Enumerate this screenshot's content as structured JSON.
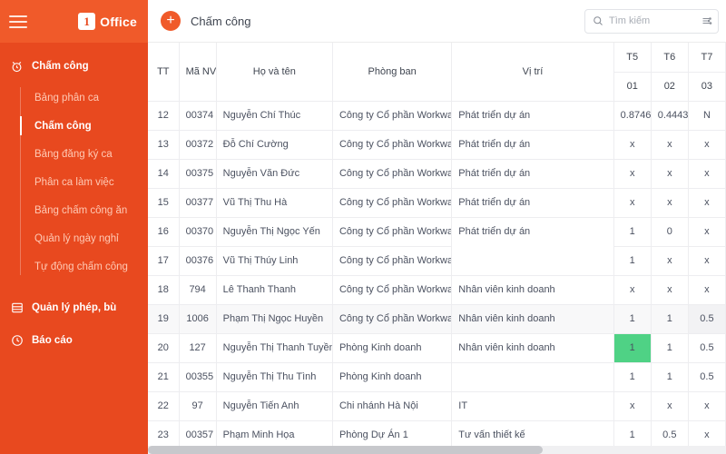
{
  "sidebar": {
    "brand_label": "Office",
    "brand_mark": "1",
    "menu_icon": "hamburger-icon",
    "sections": [
      {
        "label": "Chấm công",
        "icon": "alarm-clock-icon",
        "children": [
          {
            "label": "Bảng phân ca",
            "active": false
          },
          {
            "label": "Chấm công",
            "active": true
          },
          {
            "label": "Bảng đăng ký ca",
            "active": false
          },
          {
            "label": "Phân ca làm việc",
            "active": false
          },
          {
            "label": "Bảng chấm công ăn",
            "active": false
          },
          {
            "label": "Quản lý ngày nghỉ",
            "active": false
          },
          {
            "label": "Tự động chấm công",
            "active": false
          }
        ]
      }
    ],
    "bottom_items": [
      {
        "label": "Quản lý phép, bù",
        "icon": "list-icon"
      },
      {
        "label": "Báo cáo",
        "icon": "clock-icon"
      }
    ],
    "colors": {
      "bar": "#F05A2A",
      "body": "#E8491F",
      "sub_text": "#FFC9B4"
    }
  },
  "topbar": {
    "add_label": "+",
    "page_title": "Chấm công",
    "search": {
      "placeholder": "Tìm kiếm",
      "value": ""
    },
    "search_icon": "search-icon",
    "filter_icon": "sliders-icon"
  },
  "table": {
    "headers": {
      "tt": "TT",
      "ma_nv": "Mã NV",
      "ho_ten": "Họ và tên",
      "phong_ban": "Phòng ban",
      "vi_tri": "Vị trí"
    },
    "day_columns": [
      {
        "weekday": "T5",
        "day": "01",
        "weekend": false
      },
      {
        "weekday": "T6",
        "day": "02",
        "weekend": false
      },
      {
        "weekday": "T7",
        "day": "03",
        "weekend": true
      }
    ],
    "rows": [
      {
        "tt": "12",
        "ma_nv": "00374",
        "ho_ten": "Nguyễn Chí Thúc",
        "phong_ban": "Công ty Cổ phần Workway",
        "vi_tri": "Phát triển dự án",
        "days": [
          {
            "v": "0.8746",
            "style": "red"
          },
          {
            "v": "0.4443",
            "style": "red"
          },
          {
            "v": "N",
            "style": "normal"
          }
        ],
        "alt": false
      },
      {
        "tt": "13",
        "ma_nv": "00372",
        "ho_ten": "Đỗ Chí Cường",
        "phong_ban": "Công ty Cổ phần Workway",
        "vi_tri": "Phát triển dự án",
        "days": [
          {
            "v": "x",
            "style": "normal"
          },
          {
            "v": "x",
            "style": "normal"
          },
          {
            "v": "x",
            "style": "normal"
          }
        ],
        "alt": false
      },
      {
        "tt": "14",
        "ma_nv": "00375",
        "ho_ten": "Nguyễn Văn Đức",
        "phong_ban": "Công ty Cổ phần Workway",
        "vi_tri": "Phát triển dự án",
        "days": [
          {
            "v": "x",
            "style": "normal"
          },
          {
            "v": "x",
            "style": "normal"
          },
          {
            "v": "x",
            "style": "normal"
          }
        ],
        "alt": false
      },
      {
        "tt": "15",
        "ma_nv": "00377",
        "ho_ten": "Vũ Thị Thu Hà",
        "phong_ban": "Công ty Cổ phần Workway",
        "vi_tri": "Phát triển dự án",
        "days": [
          {
            "v": "x",
            "style": "normal"
          },
          {
            "v": "x",
            "style": "normal"
          },
          {
            "v": "x",
            "style": "normal"
          }
        ],
        "alt": false
      },
      {
        "tt": "16",
        "ma_nv": "00370",
        "ho_ten": "Nguyễn Thị Ngọc Yến",
        "phong_ban": "Công ty Cổ phần Workway",
        "vi_tri": "Phát triển dự án",
        "vi_tri_rowspan": 2,
        "days": [
          {
            "v": "1",
            "style": "normal"
          },
          {
            "v": "0",
            "style": "normal"
          },
          {
            "v": "x",
            "style": "normal"
          }
        ],
        "alt": false
      },
      {
        "tt": "17",
        "ma_nv": "00376",
        "ho_ten": "Vũ Thị Thúy Linh",
        "phong_ban": "Công ty Cổ phần Workway",
        "vi_tri": "",
        "vi_tri_skip": true,
        "days": [
          {
            "v": "1",
            "style": "normal"
          },
          {
            "v": "x",
            "style": "normal"
          },
          {
            "v": "x",
            "style": "normal"
          }
        ],
        "alt": false
      },
      {
        "tt": "18",
        "ma_nv": "794",
        "ho_ten": "Lê Thanh Thanh",
        "phong_ban": "Công ty Cổ phần Workway",
        "vi_tri": "Nhân viên kinh doanh",
        "days": [
          {
            "v": "x",
            "style": "normal"
          },
          {
            "v": "x",
            "style": "normal"
          },
          {
            "v": "x",
            "style": "normal"
          }
        ],
        "alt": false
      },
      {
        "tt": "19",
        "ma_nv": "1006",
        "ho_ten": "Phạm Thị Ngọc Huyền",
        "phong_ban": "Công ty Cổ phần Workway",
        "vi_tri": "Nhân viên kinh doanh",
        "days": [
          {
            "v": "1",
            "style": "normal"
          },
          {
            "v": "1",
            "style": "normal"
          },
          {
            "v": "0.5",
            "style": "normal"
          }
        ],
        "alt": true
      },
      {
        "tt": "20",
        "ma_nv": "127",
        "ho_ten": "Nguyễn Thị Thanh Tuyền",
        "phong_ban": "Phòng Kinh doanh",
        "vi_tri": "Nhân viên kinh doanh",
        "days": [
          {
            "v": "1",
            "style": "green"
          },
          {
            "v": "1",
            "style": "normal"
          },
          {
            "v": "0.5",
            "style": "normal"
          }
        ],
        "alt": false
      },
      {
        "tt": "21",
        "ma_nv": "00355",
        "ho_ten": "Nguyễn Thị Thu Tình",
        "phong_ban": "Phòng Kinh doanh",
        "vi_tri": "",
        "days": [
          {
            "v": "1",
            "style": "normal"
          },
          {
            "v": "1",
            "style": "normal"
          },
          {
            "v": "0.5",
            "style": "normal"
          }
        ],
        "alt": false
      },
      {
        "tt": "22",
        "ma_nv": "97",
        "ho_ten": "Nguyễn Tiến Anh",
        "phong_ban": "Chi nhánh Hà Nội",
        "vi_tri": "IT",
        "days": [
          {
            "v": "x",
            "style": "normal"
          },
          {
            "v": "x",
            "style": "normal"
          },
          {
            "v": "x",
            "style": "normal"
          }
        ],
        "alt": false
      },
      {
        "tt": "23",
        "ma_nv": "00357",
        "ho_ten": "Phạm Minh Họa",
        "phong_ban": "Phòng Dự Án 1",
        "vi_tri": "Tư vấn thiết kế",
        "days": [
          {
            "v": "1",
            "style": "normal"
          },
          {
            "v": "0.5",
            "style": "red"
          },
          {
            "v": "x",
            "style": "normal"
          }
        ],
        "alt": false
      }
    ]
  }
}
